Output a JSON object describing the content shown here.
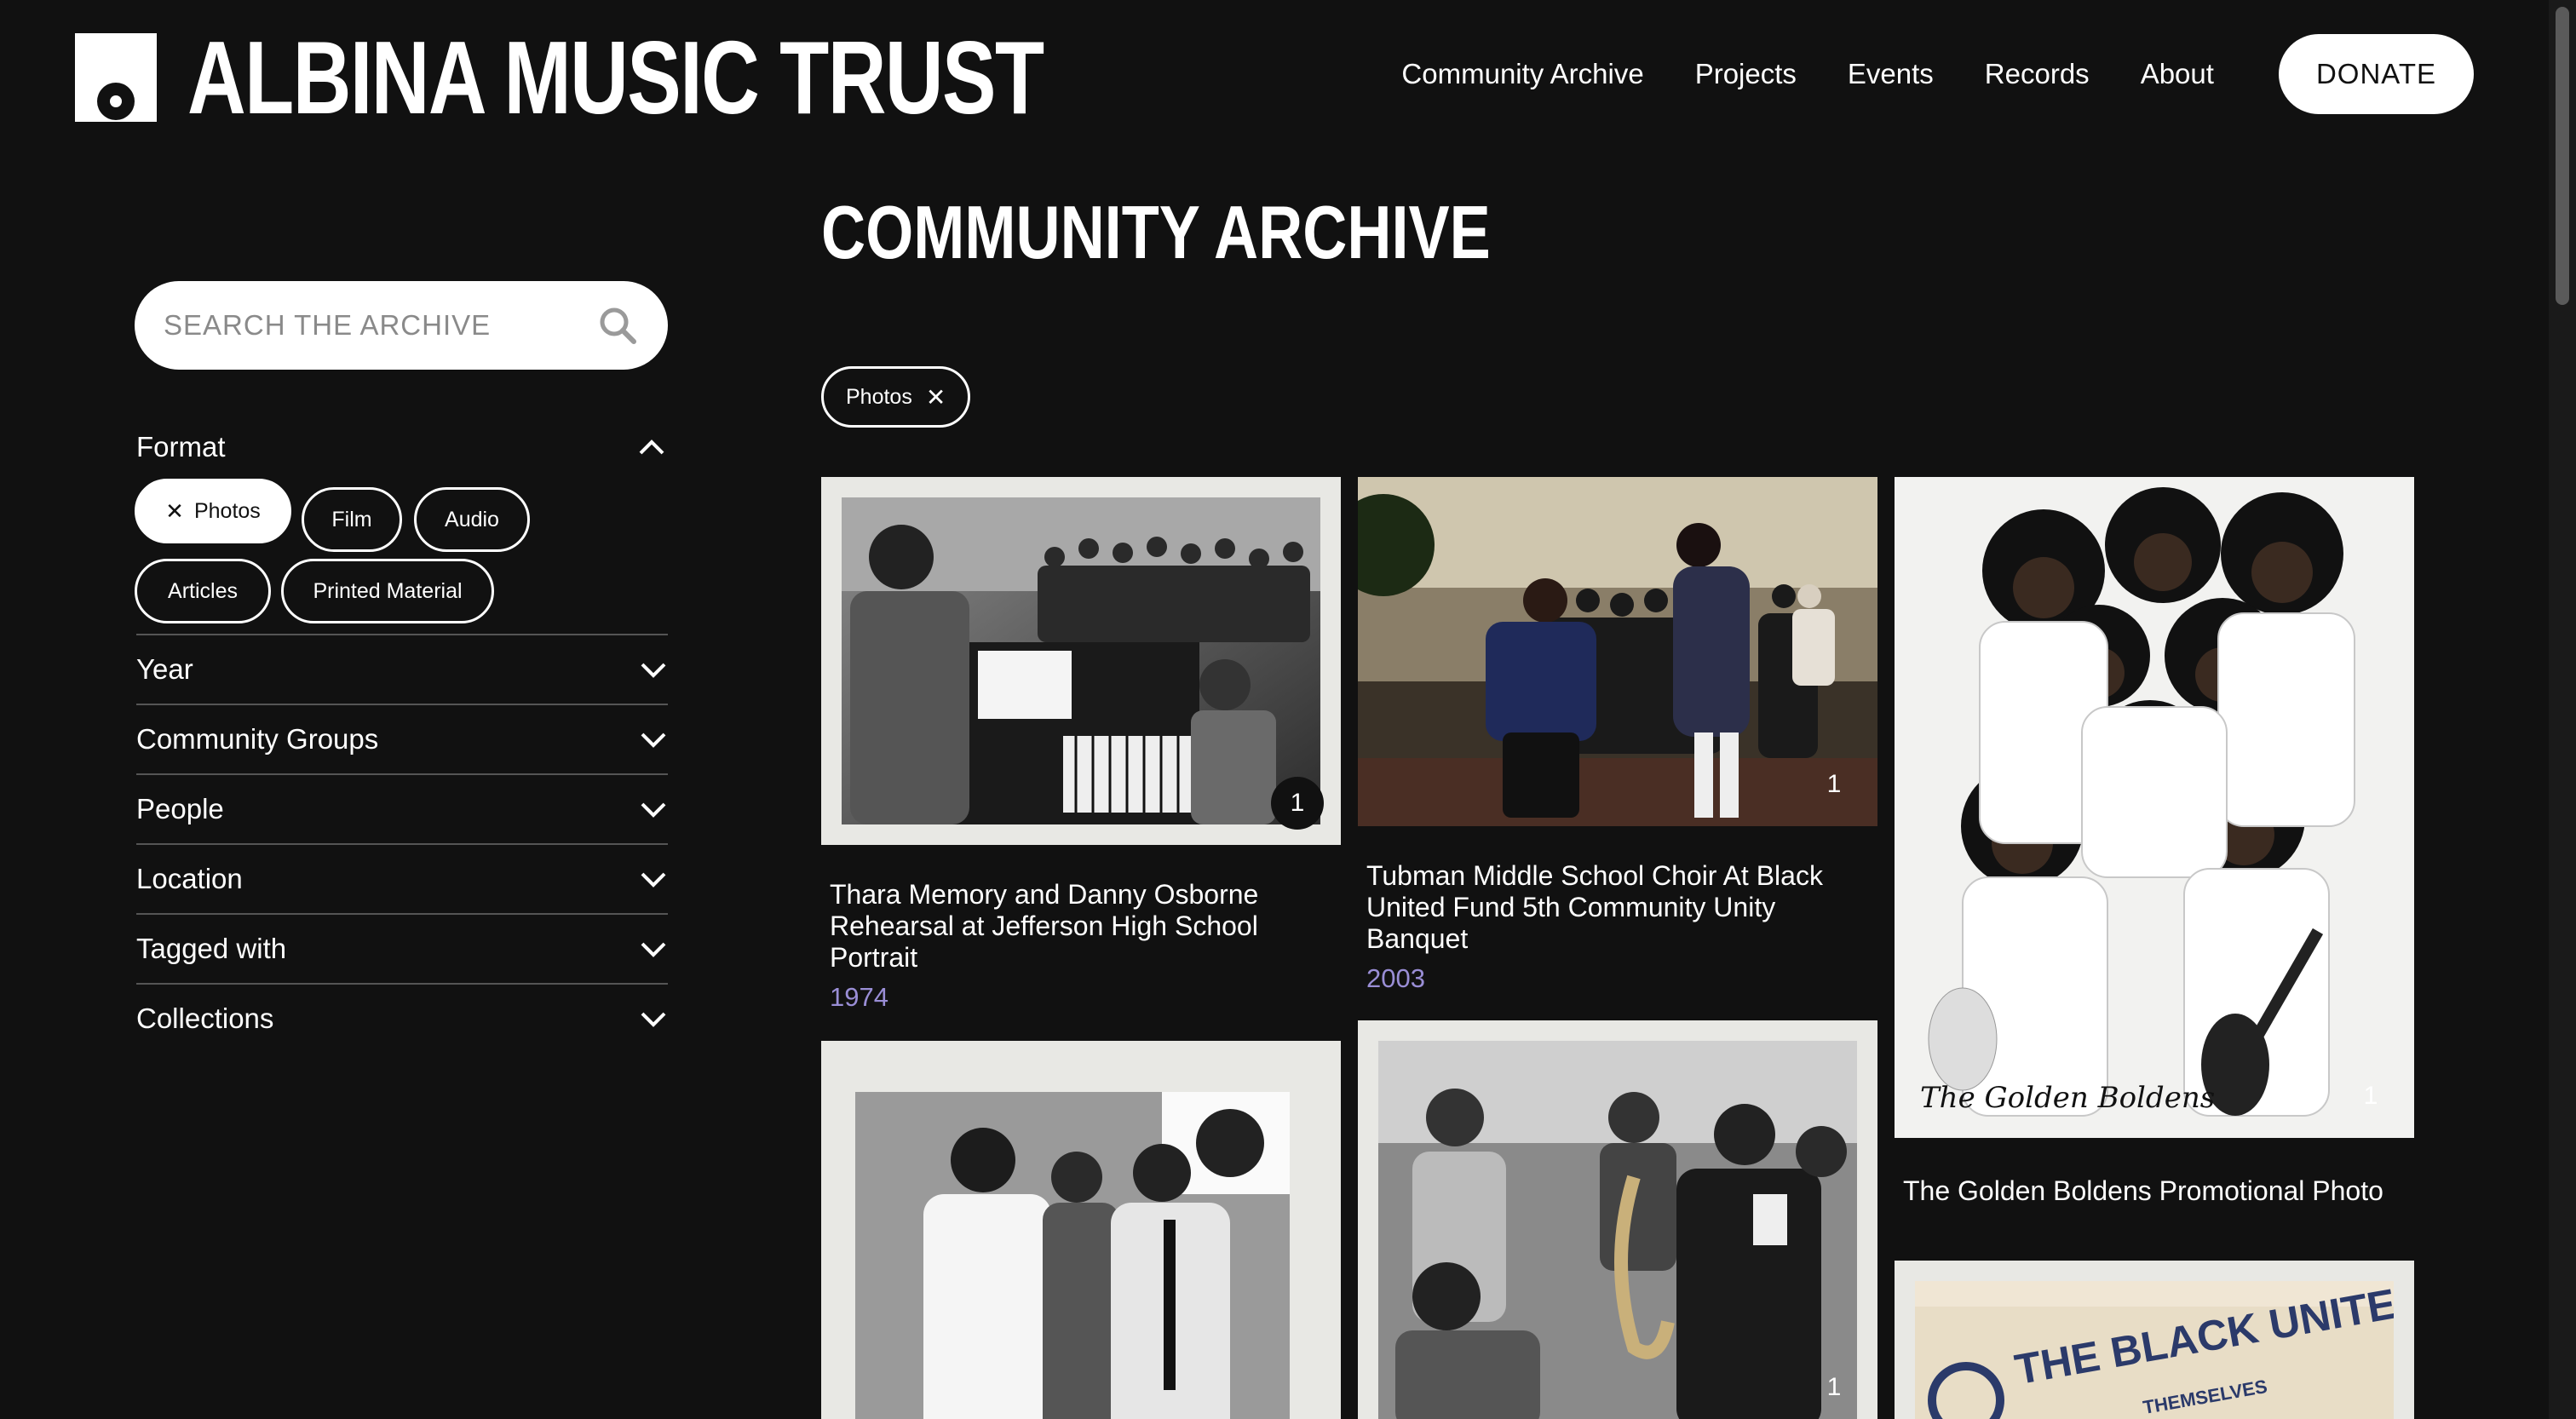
{
  "header": {
    "logo_text": "ALBINA MUSIC TRUST",
    "nav": [
      "Community Archive",
      "Projects",
      "Events",
      "Records",
      "About"
    ],
    "donate": "DONATE"
  },
  "sidebar": {
    "search_placeholder": "SEARCH THE ARCHIVE",
    "format": {
      "label": "Format",
      "options": [
        "Photos",
        "Film",
        "Audio",
        "Articles",
        "Printed Material"
      ],
      "selected": "Photos"
    },
    "facets": [
      "Year",
      "Community Groups",
      "People",
      "Location",
      "Tagged with",
      "Collections"
    ]
  },
  "main": {
    "title": "COMMUNITY ARCHIVE",
    "active_filter": "Photos",
    "cards": [
      {
        "title": "Thara Memory and Danny Osborne Rehearsal at Jefferson High School Portrait",
        "year": "1974",
        "count": "1"
      },
      {
        "title": "Tubman Middle School Choir At Black United Fund 5th Community Unity Banquet",
        "year": "2003",
        "count": "1"
      },
      {
        "title": "The Golden Boldens Promotional Photo",
        "year": "",
        "count": "1"
      },
      {
        "title": "",
        "year": "",
        "count": ""
      },
      {
        "title": "",
        "year": "",
        "count": "1"
      },
      {
        "title": "",
        "year": "",
        "count": ""
      }
    ],
    "image_captions": {
      "golden_boldens": "The Golden Boldens",
      "black_united_fund": "THE BLACK UNITED FUND OF OREGON",
      "themselves": "THEMSELVES"
    }
  },
  "colors": {
    "background": "#111111",
    "year_accent": "#9a8ed6"
  }
}
